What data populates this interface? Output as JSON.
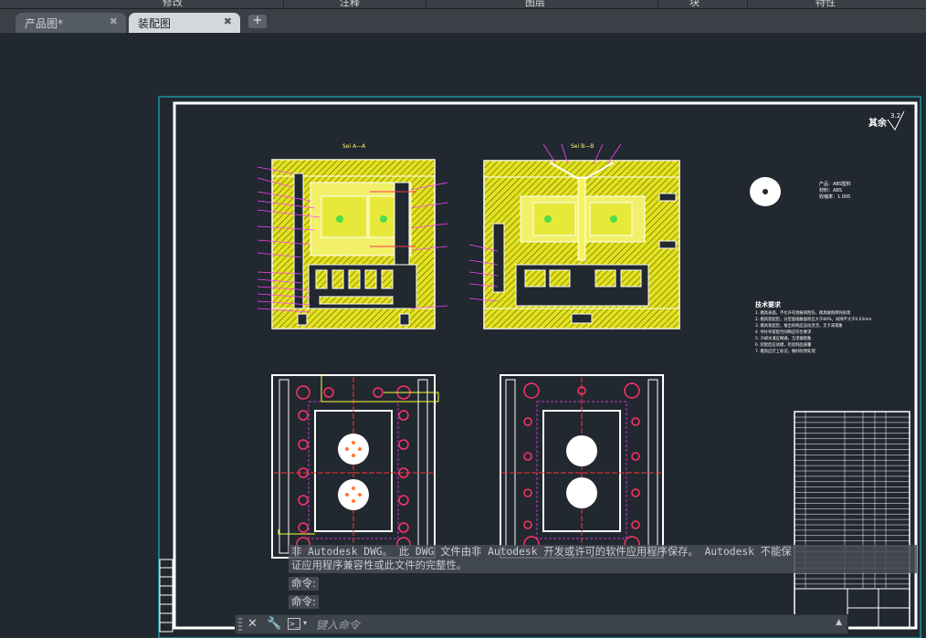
{
  "ribbon": {
    "groups": [
      "修改",
      "注释",
      "图层",
      "块",
      "特性"
    ]
  },
  "tabs": [
    {
      "label": "产品图*",
      "active": false
    },
    {
      "label": "装配图",
      "active": true
    }
  ],
  "drawing": {
    "section_aa": "Sei A—A",
    "section_bb": "Sei B—B",
    "roughness_text": "其余",
    "roughness_value": "3.2",
    "product_notes": [
      "产品：ABS塑料",
      "材料：ABS",
      "收缩率：1.005"
    ],
    "tech_title": "技术要求",
    "tech_lines": [
      "1. 模具表面，不允许有划痕和刮伤，模具棱角倒钝处理",
      "2. 模具装配后，分型面接触面积应大于80%，间隙不大于0.03mm",
      "3. 模具装配后，推出机构应运动灵活，无卡滞现象",
      "4. 导柱导套配合间隙应符合要求",
      "5. 冷却水道应畅通，无渗漏现象",
      "6. 装配后应试模，检验制品质量",
      "7. 模具应打上标记，做好防锈处理"
    ]
  },
  "command": {
    "message_line1": "非 Autodesk DWG。 此 DWG 文件由非 Autodesk 开发或许可的软件应用程序保存。 Autodesk 不能保",
    "message_line2": "证应用程序兼容性或此文件的完整性。",
    "history": [
      "命令:",
      "命令:"
    ],
    "placeholder": "键入命令"
  }
}
